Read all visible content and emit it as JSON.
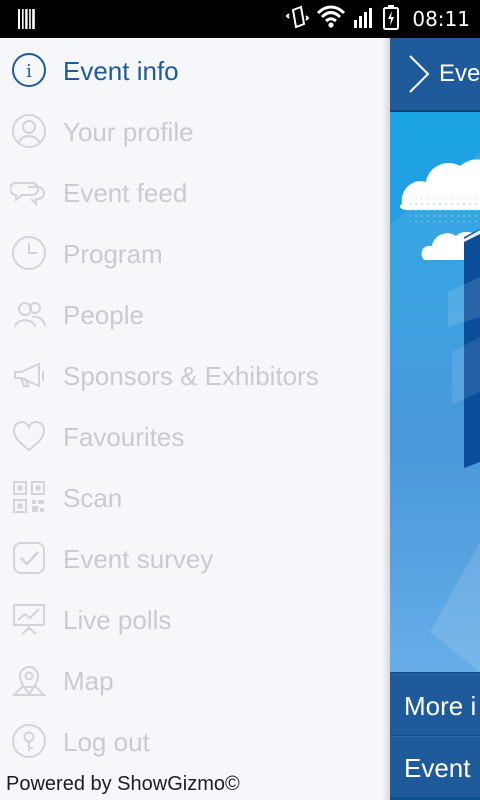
{
  "status_bar": {
    "time": "08:11",
    "icons": [
      "barcode-icon",
      "vibrate-icon",
      "wifi-icon",
      "signal-icon",
      "battery-charging-icon"
    ]
  },
  "drawer": {
    "items": [
      {
        "label": "Event info",
        "icon": "info-icon",
        "active": true
      },
      {
        "label": "Your profile",
        "icon": "profile-icon",
        "active": false
      },
      {
        "label": "Event feed",
        "icon": "chat-bubbles-icon",
        "active": false
      },
      {
        "label": "Program",
        "icon": "clock-icon",
        "active": false
      },
      {
        "label": "People",
        "icon": "people-icon",
        "active": false
      },
      {
        "label": "Sponsors & Exhibitors",
        "icon": "megaphone-icon",
        "active": false
      },
      {
        "label": "Favourites",
        "icon": "heart-icon",
        "active": false
      },
      {
        "label": "Scan",
        "icon": "qr-code-icon",
        "active": false
      },
      {
        "label": "Event survey",
        "icon": "checkbox-icon",
        "active": false
      },
      {
        "label": "Live polls",
        "icon": "presentation-chart-icon",
        "active": false
      },
      {
        "label": "Map",
        "icon": "map-pin-icon",
        "active": false
      },
      {
        "label": "Log out",
        "icon": "logout-icon",
        "active": false
      }
    ],
    "powered_by": "Powered by ShowGizmo",
    "copyright_symbol": "©"
  },
  "right_panel": {
    "header_title": "Eve",
    "bars": [
      "More i",
      "Event"
    ]
  },
  "colors": {
    "active": "#1f5a9a",
    "inactive": "#c9cbd1",
    "header": "#1f5a9a"
  }
}
